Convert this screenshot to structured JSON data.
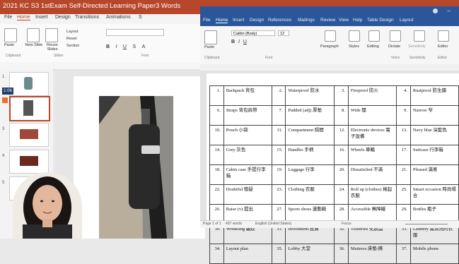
{
  "powerpoint": {
    "title": "2021 KC S3 1stExam Self-Directed Learning Paper3 Words",
    "menu": [
      "File",
      "Home",
      "Insert",
      "Design",
      "Transitions",
      "Animations",
      "S"
    ],
    "ribbon": {
      "paste": "Paste",
      "new_slide": "New Slide",
      "reuse_slides": "Reuse Slides",
      "layout": "Layout",
      "reset": "Reset",
      "section": "Section",
      "groups": [
        "Clipboard",
        "Slides",
        "Font"
      ]
    },
    "timer": "1:06",
    "slide_numbers": [
      "1",
      "2",
      "3",
      "4",
      "5"
    ],
    "colors": {
      "accent": "#b7472a"
    }
  },
  "word": {
    "tabs": [
      "File",
      "Home",
      "Insert",
      "Design",
      "References",
      "Mailings",
      "Review",
      "View",
      "Help",
      "Table Design",
      "Layout"
    ],
    "ribbon": {
      "font_name": "Calibri (Body)",
      "font_size": "12",
      "paragraph": "Paragraph",
      "styles": "Styles",
      "editing": "Editing",
      "dictate": "Dictate",
      "sensitivity": "Sensitivity",
      "editor": "Editor",
      "groups": [
        "Clipboard",
        "Font",
        "Voice",
        "Sensitivity",
        "Editor"
      ]
    },
    "status": {
      "page": "Page 1 of 1",
      "words": "437 words",
      "language": "English (United States)",
      "focus": "Focus"
    },
    "colors": {
      "accent": "#2b579a"
    },
    "table": [
      [
        [
          "1.",
          "Backpack 背包"
        ],
        [
          "2.",
          "Waterproof 防水"
        ],
        [
          "3.",
          "Fireproof 防火"
        ],
        [
          "4.",
          "Rustproof 防生鏽"
        ]
      ],
      [
        [
          "6.",
          "Straps 背包肩帶"
        ],
        [
          "7.",
          "Padded (adj) 厚墊"
        ],
        [
          "8.",
          "Wide 闊"
        ],
        [
          "9.",
          "Narrow 窄"
        ]
      ],
      [
        [
          "10.",
          "Pouch 小袋"
        ],
        [
          "11.",
          "Compartment 隔間"
        ],
        [
          "12.",
          "Electronic devices 電子設備"
        ],
        [
          "13.",
          "Navy blue 深藍色"
        ]
      ],
      [
        [
          "14.",
          "Grey 灰色"
        ],
        [
          "15.",
          "Handles 手柄"
        ],
        [
          "16.",
          "Wheels 車輪"
        ],
        [
          "17.",
          "Suitcase 行李箱"
        ]
      ],
      [
        [
          "18.",
          "Cabin case 手提行李箱"
        ],
        [
          "19.",
          "Luggage 行李"
        ],
        [
          "20.",
          "Dissatisfied 不滿"
        ],
        [
          "21.",
          "Pleased 滿意"
        ]
      ],
      [
        [
          "22.",
          "Doubtful 懷疑"
        ],
        [
          "23.",
          "Clothing 衣服"
        ],
        [
          "24.",
          "Roll up (clothes) 捲起衣服"
        ],
        [
          "25.",
          "Smart occasion 時尚場合"
        ]
      ],
      [
        [
          "26.",
          "Raise (v) 提出"
        ],
        [
          "27.",
          "Sports shoes 運動鞋"
        ],
        [
          "28.",
          "Accessible 無障礙"
        ],
        [
          "29.",
          "Bottles 瓶子"
        ]
      ],
      [
        [
          "30.",
          "Wrinkling 皺紋"
        ],
        [
          "31.",
          "Investment 投資"
        ],
        [
          "32.",
          "Toiletries 化妝品"
        ],
        [
          "33.",
          "Laundry 需清洗的衣服"
        ]
      ],
      [
        [
          "34.",
          "Layout plan"
        ],
        [
          "35.",
          "Lobby 大堂"
        ],
        [
          "36.",
          "Mattress 床墊/褥"
        ],
        [
          "37.",
          "Mobile phone"
        ]
      ]
    ]
  }
}
